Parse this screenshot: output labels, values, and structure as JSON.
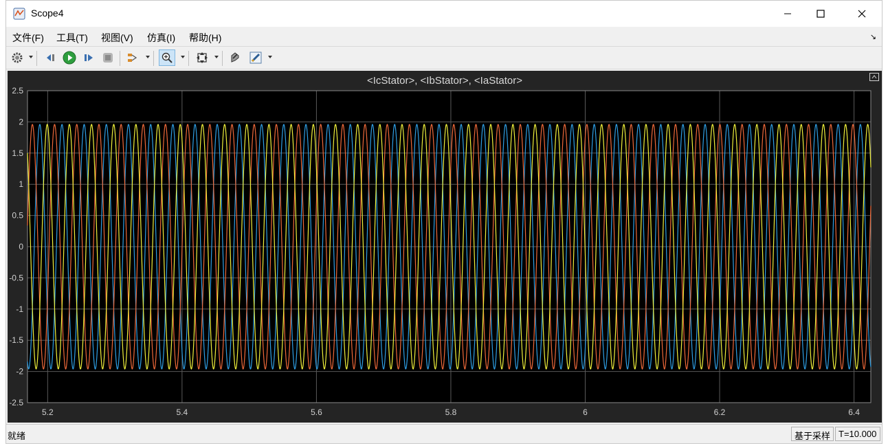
{
  "window": {
    "title": "Scope4",
    "icon": "scope-app-icon"
  },
  "window_controls": [
    "minimize-icon",
    "maximize-icon",
    "close-icon"
  ],
  "menu": [
    {
      "label": "文件(F)"
    },
    {
      "label": "工具(T)"
    },
    {
      "label": "视图(V)"
    },
    {
      "label": "仿真(I)"
    },
    {
      "label": "帮助(H)"
    }
  ],
  "toolbar": {
    "icons": [
      "gear-icon",
      "step-back-icon",
      "run-icon",
      "step-forward-icon",
      "stop-icon",
      "signal-select-icon",
      "zoom-in-icon",
      "autoscale-icon",
      "style-icon",
      "highlight-icon"
    ]
  },
  "plot": {
    "title": "<IcStator>, <IbStator>, <IaStator>",
    "colors": {
      "background": "#000000",
      "frame": "#242424",
      "grid": "#5a5a5a",
      "ic": "#2fa0e6",
      "ib": "#f06a3a",
      "ia": "#f2f23c"
    }
  },
  "chart_data": {
    "type": "line",
    "title": "<IcStator>, <IbStator>, <IaStator>",
    "xlabel": "",
    "ylabel": "",
    "xlim": [
      5.17,
      6.425
    ],
    "ylim": [
      -2.5,
      2.5
    ],
    "x_ticks": [
      "5.2",
      "5.4",
      "5.6",
      "5.8",
      "6",
      "6.2",
      "6.4"
    ],
    "y_ticks": [
      "2.5",
      "2",
      "1.5",
      "1",
      "0.5",
      "0",
      "-0.5",
      "-1",
      "-1.5",
      "-2",
      "-2.5"
    ],
    "grid": true,
    "series": [
      {
        "name": "IcStator",
        "color": "#2fa0e6",
        "amplitude": 1.96,
        "frequency_hz": 30.3,
        "phase_deg_at_x_start": 250
      },
      {
        "name": "IbStator",
        "color": "#f06a3a",
        "amplitude": 1.96,
        "frequency_hz": 30.3,
        "phase_deg_at_x_start": 10
      },
      {
        "name": "IaStator",
        "color": "#f2f23c",
        "amplitude": 1.96,
        "frequency_hz": 30.3,
        "phase_deg_at_x_start": 130
      }
    ]
  },
  "status": {
    "left": "就绪",
    "mode": "基于采样",
    "time": "T=10.000"
  }
}
